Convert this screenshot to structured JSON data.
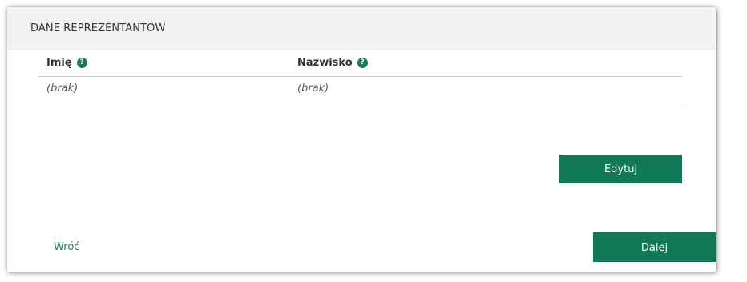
{
  "panel": {
    "title": "DANE REPREZENTANTÓW"
  },
  "table": {
    "columns": [
      {
        "label": "Imię",
        "help_icon": "question-circle-icon",
        "help_glyph": "?"
      },
      {
        "label": "Nazwisko",
        "help_icon": "question-circle-icon",
        "help_glyph": "?"
      }
    ],
    "rows": [
      [
        "(brak)",
        "(brak)"
      ]
    ]
  },
  "actions": {
    "edit_label": "Edytuj",
    "back_label": "Wróć",
    "next_label": "Dalej"
  },
  "colors": {
    "accent": "#117a55",
    "header_bg": "#f2f2f2"
  }
}
